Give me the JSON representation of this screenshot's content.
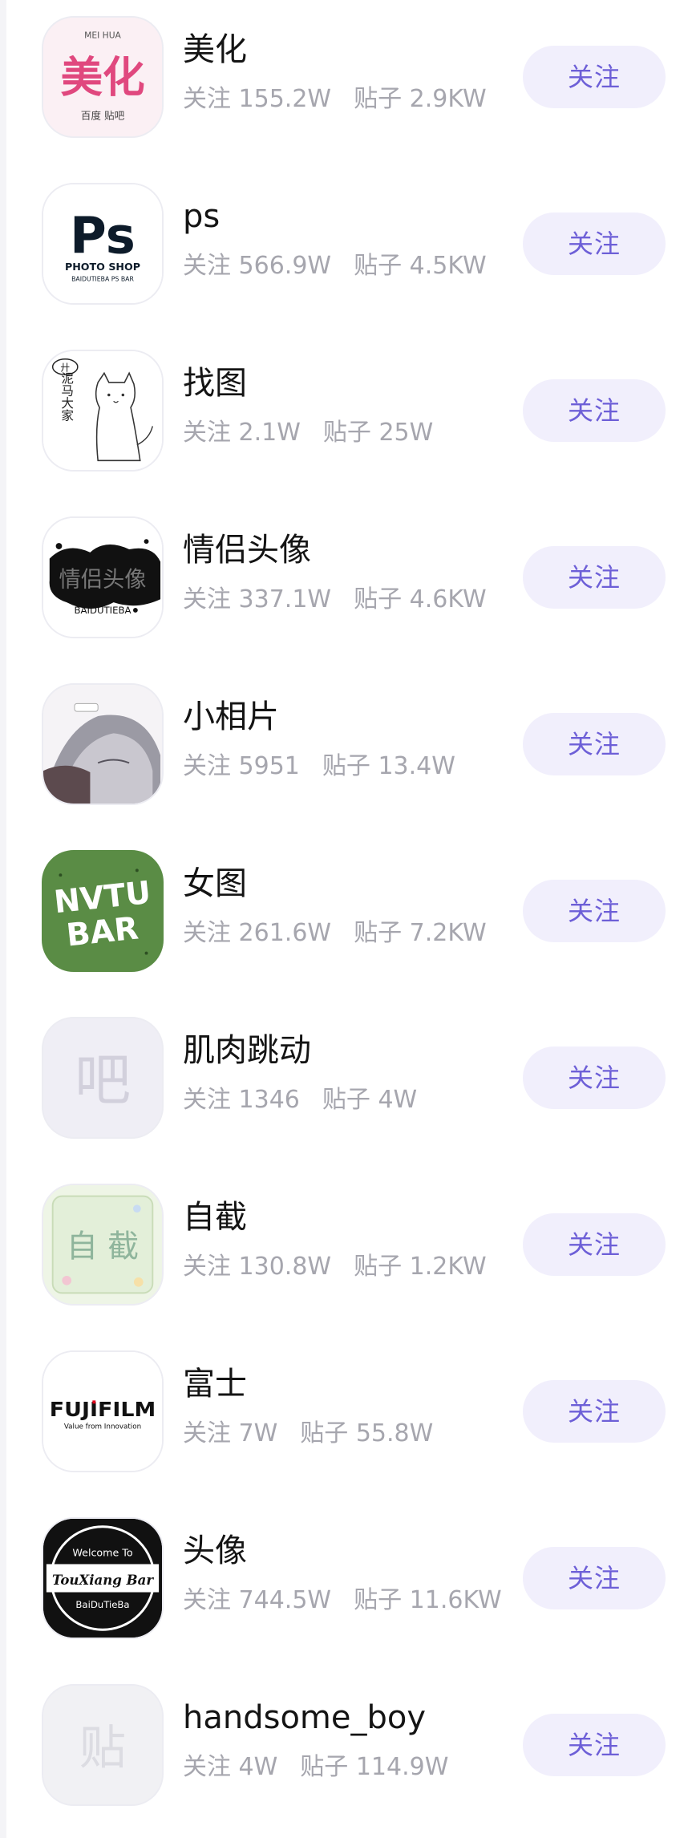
{
  "follow_label": "关注",
  "items": [
    {
      "name": "美化",
      "followers_label": "关注",
      "followers": "155.2W",
      "posts_label": "贴子",
      "posts": "2.9KW",
      "icon": "meihua-forum-icon"
    },
    {
      "name": "ps",
      "followers_label": "关注",
      "followers": "566.9W",
      "posts_label": "贴子",
      "posts": "4.5KW",
      "icon": "photoshop-logo-icon"
    },
    {
      "name": "找图",
      "followers_label": "关注",
      "followers": "2.1W",
      "posts_label": "贴子",
      "posts": "25W",
      "icon": "cat-sketch-icon"
    },
    {
      "name": "情侣头像",
      "followers_label": "关注",
      "followers": "337.1W",
      "posts_label": "贴子",
      "posts": "4.6KW",
      "icon": "ink-splash-icon"
    },
    {
      "name": "小相片",
      "followers_label": "关注",
      "followers": "5951",
      "posts_label": "贴子",
      "posts": "13.4W",
      "icon": "anime-portrait-icon"
    },
    {
      "name": "女图",
      "followers_label": "关注",
      "followers": "261.6W",
      "posts_label": "贴子",
      "posts": "7.2KW",
      "icon": "nvtu-bar-logo-icon"
    },
    {
      "name": "肌肉跳动",
      "followers_label": "关注",
      "followers": "1346",
      "posts_label": "贴子",
      "posts": "4W",
      "icon": "default-bar-icon"
    },
    {
      "name": "自截",
      "followers_label": "关注",
      "followers": "130.8W",
      "posts_label": "贴子",
      "posts": "1.2KW",
      "icon": "zijie-forum-icon"
    },
    {
      "name": "富士",
      "followers_label": "关注",
      "followers": "7W",
      "posts_label": "贴子",
      "posts": "55.8W",
      "icon": "fujifilm-logo-icon"
    },
    {
      "name": "头像",
      "followers_label": "关注",
      "followers": "744.5W",
      "posts_label": "贴子",
      "posts": "11.6KW",
      "icon": "touxiang-badge-icon"
    },
    {
      "name": "handsome_boy",
      "followers_label": "关注",
      "followers": "4W",
      "posts_label": "贴子",
      "posts": "114.9W",
      "icon": "default-tie-icon"
    }
  ],
  "avatar_text": {
    "meihua_big": "美化",
    "meihua_top": "MEI HUA",
    "meihua_bottom": "百度 贴吧",
    "ps_logo": "Ps",
    "ps_line1": "PHOTO SHOP",
    "ps_line2": "BAIDUTIEBA PS BAR",
    "zhaotu_vertical": "泥马大家",
    "zhaotu_mark": "廾",
    "qinglv_ink": "情侣头像",
    "qinglv_sub": "BAIDUTIEBA",
    "nvtu_line1": "NVTU",
    "nvtu_line2": "BAR",
    "bar_glyph": "吧",
    "zijie_big": "自 截",
    "fuji_logo": "FUJIFILM",
    "fuji_tag": "Value from Innovation",
    "tx_top": "Welcome To",
    "tx_mid": "TouXiang Bar",
    "tx_bottom": "BaiDuTieBa",
    "tie_glyph": "贴"
  },
  "colors": {
    "accent": "#6d5fd7",
    "button_bg": "#f1effc",
    "name": "#141414",
    "meta": "#a6a6ae",
    "nvtu_green": "#5a8c45",
    "meihua_pink": "#e0487e"
  }
}
